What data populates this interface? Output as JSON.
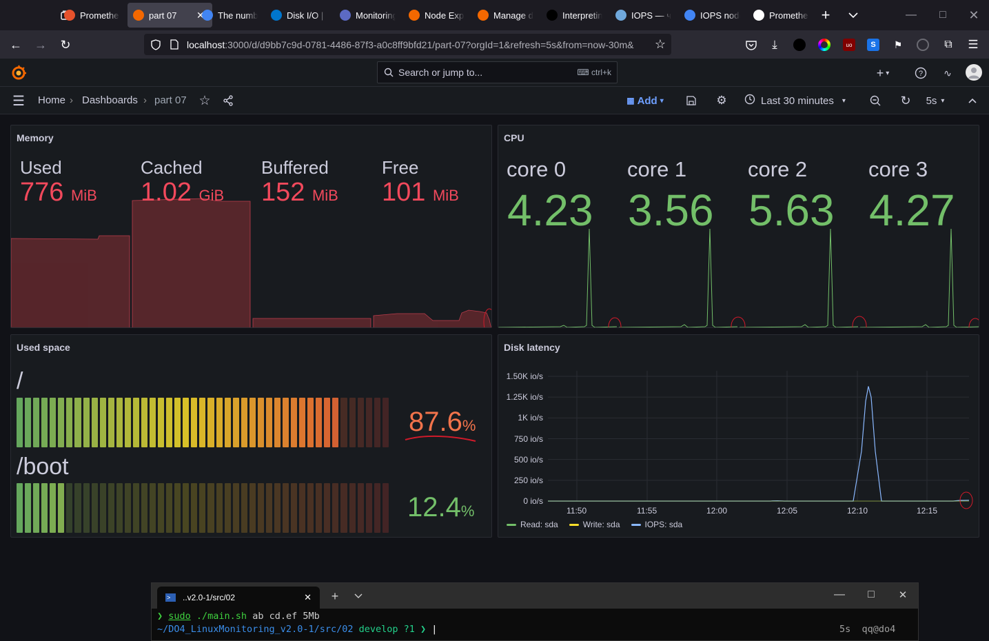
{
  "browser": {
    "tabs": [
      {
        "label": "Promethe",
        "favicon_color": "#e6522c",
        "active": false
      },
      {
        "label": "part 07",
        "favicon_color": "#f46800",
        "active": true
      },
      {
        "label": "The numb",
        "favicon_color": "#4285f4",
        "active": false
      },
      {
        "label": "Disk I/O | P",
        "favicon_color": "#0076ce",
        "active": false
      },
      {
        "label": "Monitoring",
        "favicon_color": "#5c6ac4",
        "active": false
      },
      {
        "label": "Node Exp",
        "favicon_color": "#f46800",
        "active": false
      },
      {
        "label": "Manage d",
        "favicon_color": "#f46800",
        "active": false
      },
      {
        "label": "Interpretin",
        "favicon_color": "#000000",
        "active": false
      },
      {
        "label": "IOPS — чт",
        "favicon_color": "#6fa8dc",
        "active": false
      },
      {
        "label": "IOPS node",
        "favicon_color": "#4285f4",
        "active": false
      },
      {
        "label": "Promethe",
        "favicon_color": "#ffffff",
        "active": false
      }
    ],
    "url_host": "localhost",
    "url_rest": ":3000/d/d9bb7c9d-0781-4486-87f3-a0c8ff9bfd21/part-07?orgId=1&refresh=5s&from=now-30m&"
  },
  "grafana": {
    "search_placeholder": "Search or jump to...",
    "search_shortcut": "ctrl+k",
    "breadcrumbs": [
      "Home",
      "Dashboards",
      "part 07"
    ],
    "add_label": "Add",
    "time_range": "Last 30 minutes",
    "refresh_interval": "5s"
  },
  "panels": {
    "memory": {
      "title": "Memory",
      "stats": [
        {
          "label": "Used",
          "value": "776",
          "unit": "MiB"
        },
        {
          "label": "Cached",
          "value": "1.02",
          "unit": "GiB"
        },
        {
          "label": "Buffered",
          "value": "152",
          "unit": "MiB"
        },
        {
          "label": "Free",
          "value": "101",
          "unit": "MiB"
        }
      ],
      "color": "#f2495c"
    },
    "cpu": {
      "title": "CPU",
      "stats": [
        {
          "label": "core 0",
          "value": "4.23"
        },
        {
          "label": "core 1",
          "value": "3.56"
        },
        {
          "label": "core 2",
          "value": "5.63"
        },
        {
          "label": "core 3",
          "value": "4.27"
        }
      ],
      "color": "#73bf69"
    },
    "used_space": {
      "title": "Used space",
      "gauges": [
        {
          "label": "/",
          "value": "87.6",
          "unit": "%",
          "fraction": 0.876,
          "color": "#f2734b"
        },
        {
          "label": "/boot",
          "value": "12.4",
          "unit": "%",
          "fraction": 0.124,
          "color": "#73bf69"
        }
      ]
    },
    "disk_latency": {
      "title": "Disk latency",
      "chart_data": {
        "type": "line",
        "y_ticks": [
          "1.50K io/s",
          "1.25K io/s",
          "1K io/s",
          "750 io/s",
          "500 io/s",
          "250 io/s",
          "0 io/s"
        ],
        "x_ticks": [
          "11:50",
          "11:55",
          "12:00",
          "12:05",
          "12:10",
          "12:15"
        ],
        "ylim": [
          0,
          1500
        ],
        "series": [
          {
            "name": "Read: sda",
            "color": "#73bf69"
          },
          {
            "name": "Write: sda",
            "color": "#fade2a"
          },
          {
            "name": "IOPS: sda",
            "color": "#8ab8ff",
            "peak_time": "12:11",
            "peak_value": 1380
          }
        ]
      }
    }
  },
  "terminal": {
    "tab_title": "..v2.0-1/src/02",
    "line1_prompt": "❯ ",
    "line1_sudo": "sudo",
    "line1_cmd": " ./main.sh",
    "line1_args": " ab cd.ef 5Mb",
    "line2_path": "~/DO4_LinuxMonitoring_v2.0-1/src/02",
    "line2_branch": " develop ?1 ❯ ",
    "right_status": "5s  qq@do4"
  }
}
